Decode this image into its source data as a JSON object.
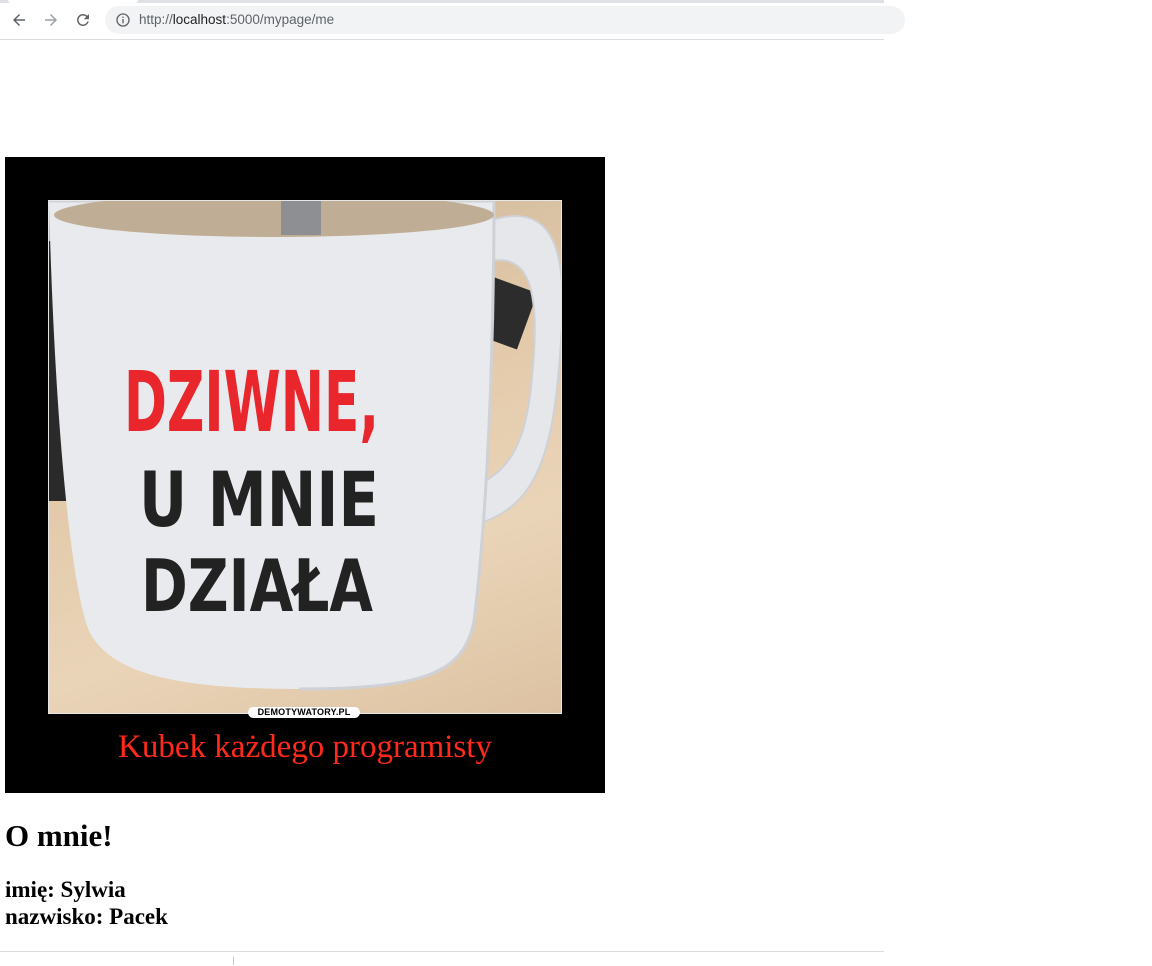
{
  "browser": {
    "url_scheme": "http://",
    "url_host": "localhost",
    "url_path": ":5000/mypage/me",
    "icons": {
      "back": "arrow-left-icon",
      "forward": "arrow-right-icon",
      "reload": "reload-icon",
      "site_info": "info-icon"
    }
  },
  "meme": {
    "mug_text_red": "DZIWNE,",
    "mug_text_line2": "U MNIE",
    "mug_text_line3": "DZIAŁA",
    "watermark": "DEMOTYWATORY.PL",
    "caption": "Kubek każdego programisty",
    "colors": {
      "caption": "#ff2a1a",
      "mug_red": "#e8262b",
      "frame": "#000000"
    }
  },
  "about": {
    "title": "O mnie!",
    "first_name_line": "imię: Sylwia",
    "last_name_line": "nazwisko: Pacek"
  }
}
